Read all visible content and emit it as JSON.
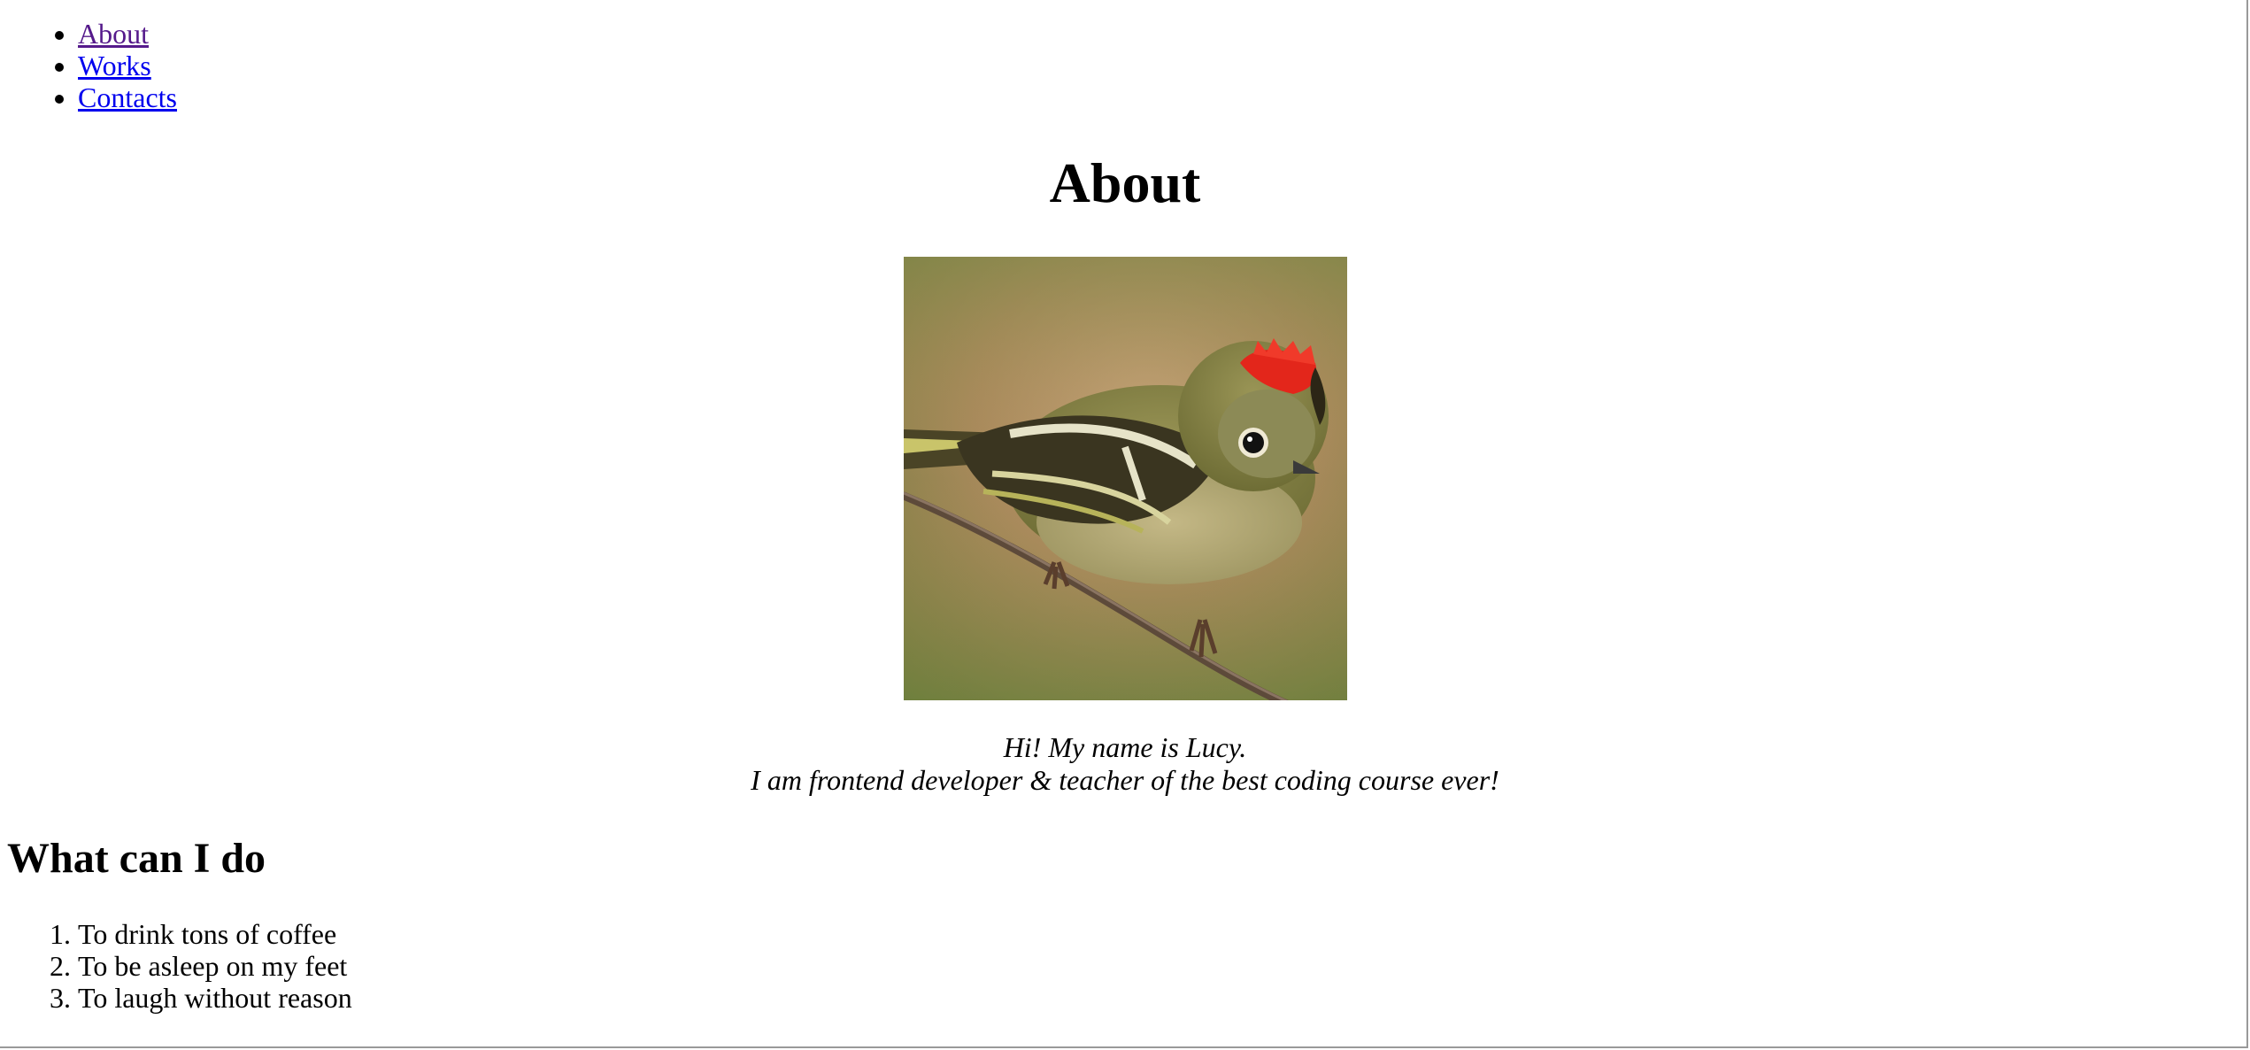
{
  "nav": {
    "items": [
      {
        "label": "About",
        "state": "visited"
      },
      {
        "label": "Works",
        "state": "link"
      },
      {
        "label": "Contacts",
        "state": "link"
      }
    ]
  },
  "main": {
    "title": "About",
    "photo": {
      "subject": "ruby-crowned kinglet bird on a branch",
      "colors": {
        "background": "#9c8550",
        "crest": "#e8281e",
        "body": "#7d7a3f"
      }
    },
    "intro": {
      "line1": "Hi! My name is Lucy.",
      "line2": "I am frontend developer & teacher of the best coding course ever!"
    }
  },
  "skills": {
    "title": "What can I do",
    "items": [
      "To drink tons of coffee",
      "To be asleep on my feet",
      "To laugh without reason"
    ]
  },
  "colors": {
    "link": "#0000ee",
    "visited_link": "#551a8b",
    "text": "#000000",
    "background": "#ffffff"
  }
}
